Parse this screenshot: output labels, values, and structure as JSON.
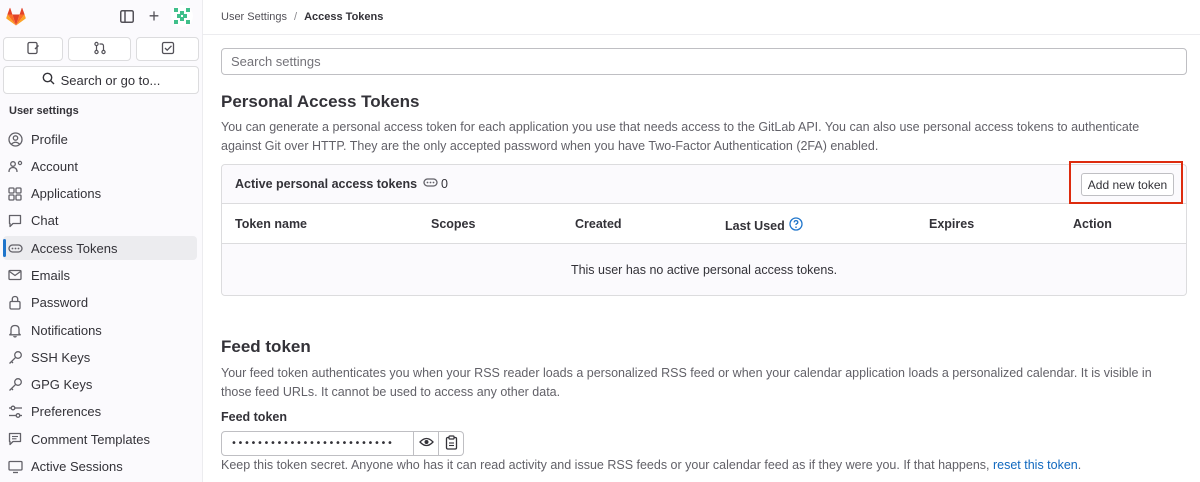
{
  "sidebar": {
    "section_title": "User settings",
    "search_label": "Search or go to...",
    "items": [
      {
        "label": "Profile",
        "icon": "profile-icon",
        "active": false
      },
      {
        "label": "Account",
        "icon": "account-icon",
        "active": false
      },
      {
        "label": "Applications",
        "icon": "applications-icon",
        "active": false
      },
      {
        "label": "Chat",
        "icon": "chat-icon",
        "active": false
      },
      {
        "label": "Access Tokens",
        "icon": "token-icon",
        "active": true
      },
      {
        "label": "Emails",
        "icon": "mail-icon",
        "active": false
      },
      {
        "label": "Password",
        "icon": "lock-icon",
        "active": false
      },
      {
        "label": "Notifications",
        "icon": "bell-icon",
        "active": false
      },
      {
        "label": "SSH Keys",
        "icon": "key-icon",
        "active": false
      },
      {
        "label": "GPG Keys",
        "icon": "key-icon",
        "active": false
      },
      {
        "label": "Preferences",
        "icon": "preferences-icon",
        "active": false
      },
      {
        "label": "Comment Templates",
        "icon": "comment-icon",
        "active": false
      },
      {
        "label": "Active Sessions",
        "icon": "monitor-icon",
        "active": false
      }
    ]
  },
  "breadcrumb": {
    "items": [
      "User Settings",
      "Access Tokens"
    ]
  },
  "search": {
    "placeholder": "Search settings"
  },
  "pat": {
    "title": "Personal Access Tokens",
    "description": "You can generate a personal access token for each application you use that needs access to the GitLab API. You can also use personal access tokens to authenticate against Git over HTTP. They are the only accepted password when you have Two-Factor Authentication (2FA) enabled.",
    "active_label": "Active personal access tokens",
    "active_count": "0",
    "add_button": "Add new token",
    "columns": [
      "Token name",
      "Scopes",
      "Created",
      "Last Used",
      "Expires",
      "Action"
    ],
    "empty_message": "This user has no active personal access tokens."
  },
  "feed": {
    "title": "Feed token",
    "description": "Your feed token authenticates you when your RSS reader loads a personalized RSS feed or when your calendar application loads a personalized calendar. It is visible in those feed URLs. It cannot be used to access any other data.",
    "field_label": "Feed token",
    "masked_value": "•••••••••••••••••••••••••",
    "help_text": "Keep this token secret. Anyone who has it can read activity and issue RSS feeds or your calendar feed as if they were you. If that happens, ",
    "help_link": "reset this token",
    "help_end": "."
  },
  "colors": {
    "accent": "#1f75cb",
    "highlight": "#dd2b0e",
    "link": "#1068bf",
    "logo_orange": "#fc6d26"
  }
}
